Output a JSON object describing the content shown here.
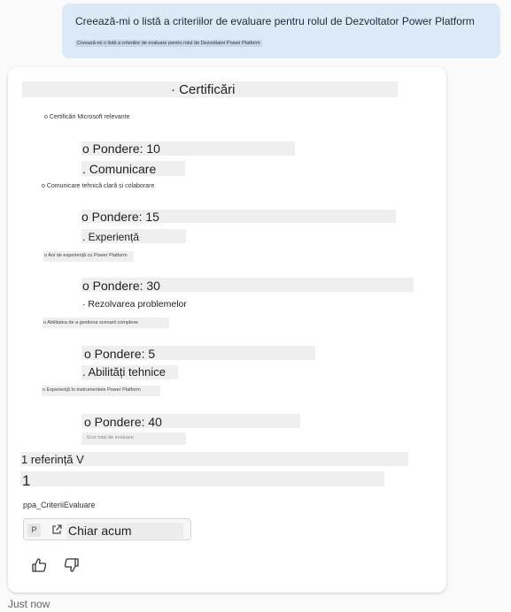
{
  "user_message": {
    "text": "Creează-mi o listă a criteriilor de evaluare pentru rolul de Dezvoltator Power Platform",
    "subtext": "Creează-mi o listă a criteriilor de evaluare pentru rolul de Dezvoltator Power Platform"
  },
  "response": {
    "heading": "· Certificări",
    "items": [
      {
        "desc": "o Certificări Microsoft relevante",
        "weight": "o Pondere: 10",
        "next": ". Comunicare"
      },
      {
        "desc": "o Comunicare tehnică clară și colaborare",
        "weight": "o Pondere: 15",
        "next": ". Experiență"
      },
      {
        "desc": "o Ani de experiență cu Power Platform",
        "weight": "o Pondere: 30",
        "next": "· Rezolvarea problemelor"
      },
      {
        "desc": "o Abilitatea de a gestiona scenarii complexe",
        "weight": "o Pondere: 5",
        "next": ". Abilități tehnice"
      },
      {
        "desc": "o Experiență în instrumentele Power Platform",
        "weight": "o Pondere: 40",
        "next": "· Scor total de evaluare"
      }
    ],
    "references_label": "1 referință V",
    "reference_number": "1",
    "reference_name": "ppa_CriteriiEvaluare",
    "reference_badge": "P",
    "reference_time": "Chiar acum"
  },
  "footer": {
    "time": "Just now"
  }
}
